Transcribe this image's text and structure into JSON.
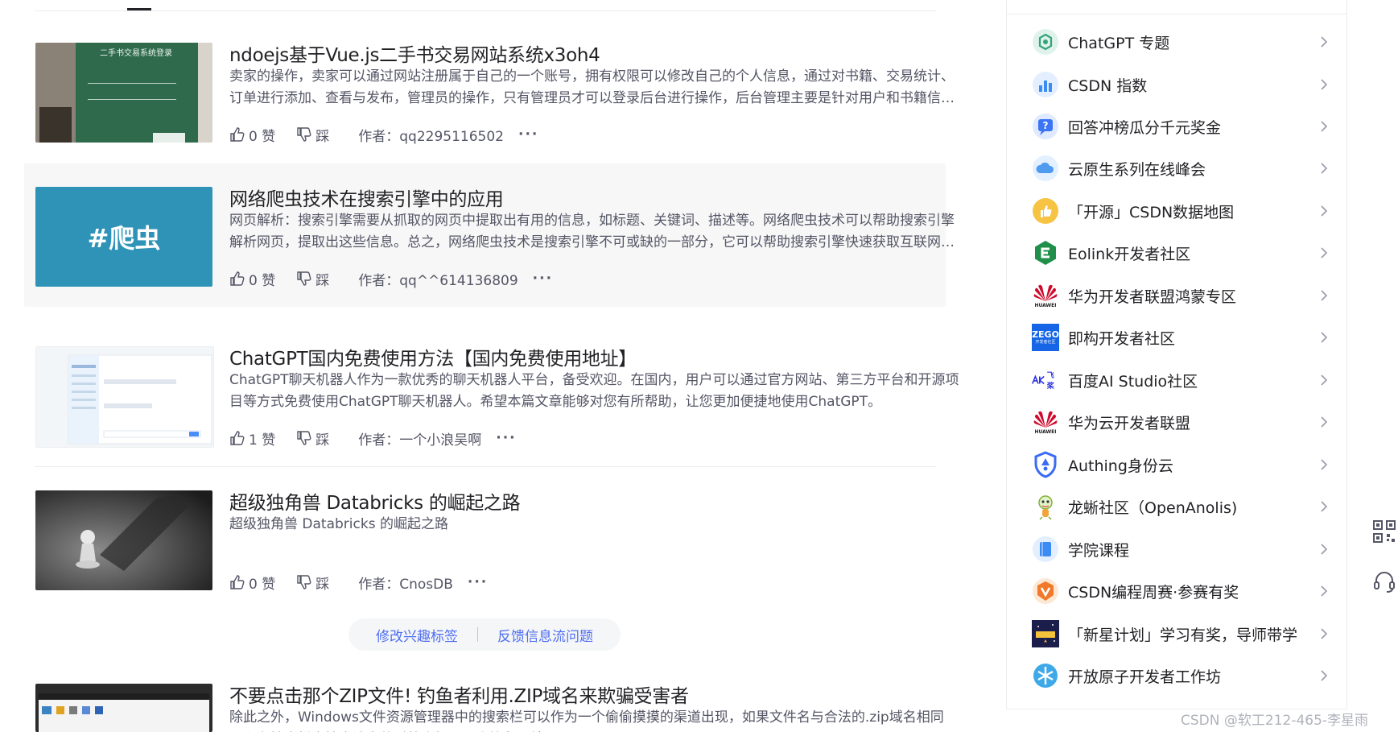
{
  "articles": [
    {
      "title": "ndoejs基于Vue.js二手书交易网站系统x3oh4",
      "desc": "卖家的操作，卖家可以通过网站注册属于自己的一个账号，拥有权限可以修改自己的个人信息，通过对书籍、交易统计、订单进行添加、查看与发布，管理员的操作，只有管理员才可以登录后台进行操作，后台管理主要是针对用户和书籍信息进行管理。",
      "likes": "0 赞",
      "dislike": "踩",
      "author": "作者：qq2295116502",
      "more": "···",
      "thumb_text": "二手书交易系统登录"
    },
    {
      "title": "网络爬虫技术在搜索引擎中的应用",
      "desc": "网页解析：搜索引擎需要从抓取的网页中提取出有用的信息，如标题、关键词、描述等。网络爬虫技术可以帮助搜索引擎解析网页，提取出这些信息。总之，网络爬虫技术是搜索引擎不可或缺的一部分，它可以帮助搜索引擎快速获取互联网上的信息。",
      "likes": "0 赞",
      "dislike": "踩",
      "author": "作者：qq^^614136809",
      "more": "···",
      "thumb_text": "#爬虫"
    },
    {
      "title": "ChatGPT国内免费使用方法【国内免费使用地址】",
      "desc": "ChatGPT聊天机器人作为一款优秀的聊天机器人平台，备受欢迎。在国内，用户可以通过官方网站、第三方平台和开源项目等方式免费使用ChatGPT聊天机器人。希望本篇文章能够对您有所帮助，让您更加便捷地使用ChatGPT。",
      "likes": "1 赞",
      "dislike": "踩",
      "author": "作者：一个小浪吴啊",
      "more": "···"
    },
    {
      "title": "超级独角兽 Databricks 的崛起之路",
      "desc": "超级独角兽 Databricks 的崛起之路",
      "likes": "0 赞",
      "dislike": "踩",
      "author": "作者：CnosDB",
      "more": "···"
    },
    {
      "title": "不要点击那个ZIP文件! 钓鱼者利用.ZIP域名来欺骗受害者",
      "desc": "除此之外，Windows文件资源管理器中的搜索栏可以作为一个偷偷摸摸的渠道出现，如果文件名与合法的.zip域名相同，那么在搜索栏中搜索该文件时将会打开一个钓鱼网站。"
    }
  ],
  "feedback": {
    "edit_tags": "修改兴趣标签",
    "feedback_stream": "反馈信息流问题"
  },
  "sidebar": {
    "items": [
      {
        "label": "ChatGPT 专题",
        "icon": "chatgpt-icon"
      },
      {
        "label": "CSDN 指数",
        "icon": "chart-icon"
      },
      {
        "label": "回答冲榜瓜分千元奖金",
        "icon": "question-icon"
      },
      {
        "label": "云原生系列在线峰会",
        "icon": "cloud-icon"
      },
      {
        "label": "「开源」CSDN数据地图",
        "icon": "thumbs-up-icon"
      },
      {
        "label": "Eolink开发者社区",
        "icon": "eolink-icon"
      },
      {
        "label": "华为开发者联盟鸿蒙专区",
        "icon": "huawei-icon"
      },
      {
        "label": "即构开发者社区",
        "icon": "zego-icon"
      },
      {
        "label": "百度AI Studio社区",
        "icon": "paddle-icon"
      },
      {
        "label": "华为云开发者联盟",
        "icon": "huawei-icon"
      },
      {
        "label": "Authing身份云",
        "icon": "shield-icon"
      },
      {
        "label": "龙蜥社区（OpenAnolis)",
        "icon": "lizard-icon"
      },
      {
        "label": "学院课程",
        "icon": "book-icon"
      },
      {
        "label": "CSDN编程周赛·参赛有奖",
        "icon": "badge-icon"
      },
      {
        "label": "「新星计划」学习有奖，导师带学",
        "icon": "star-plan-icon"
      },
      {
        "label": "开放原子开发者工作坊",
        "icon": "atom-icon"
      }
    ],
    "huawei_tag": "HUAWEI",
    "zego_text": "ZEGO",
    "zego_sub": "开发者社区",
    "paddle_text": "飞桨"
  },
  "watermark": "CSDN @软工212-465-李星雨",
  "colors": {
    "link_blue": "#4e6ef2",
    "text_main": "#222226",
    "text_sub": "#555666",
    "highlight_bg": "#f7f7f7"
  }
}
